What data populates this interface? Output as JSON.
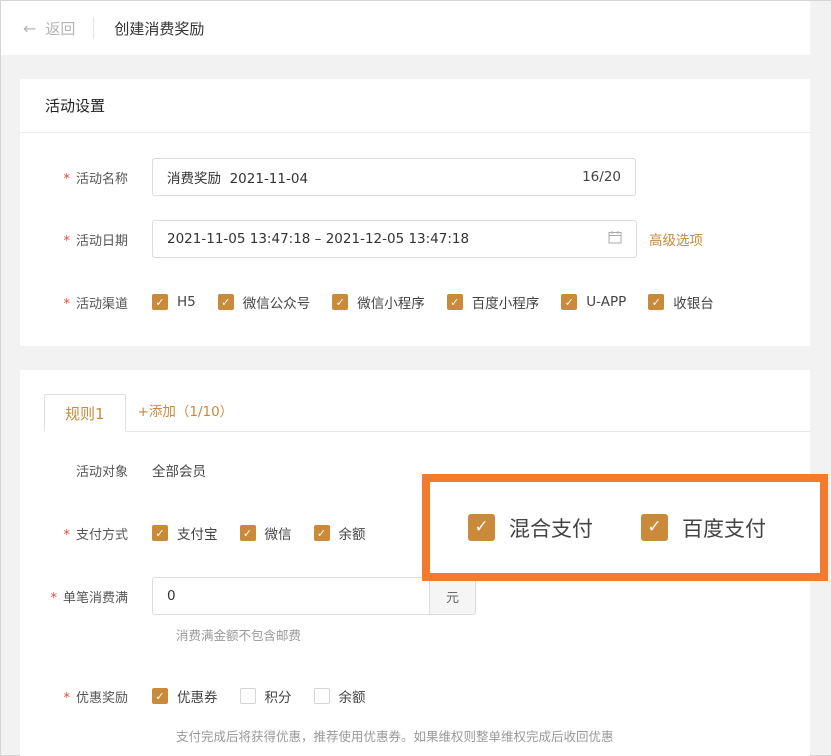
{
  "topbar": {
    "back_label": "返回",
    "title": "创建消费奖励"
  },
  "activity": {
    "section_title": "活动设置",
    "name": {
      "label": "活动名称",
      "value": "消费奖励  2021-11-04",
      "count": "16/20"
    },
    "date": {
      "label": "活动日期",
      "value": "2021-11-05 13:47:18 – 2021-12-05 13:47:18",
      "advanced": "高级选项"
    },
    "channels": {
      "label": "活动渠道",
      "items": [
        {
          "label": "H5",
          "checked": true
        },
        {
          "label": "微信公众号",
          "checked": true
        },
        {
          "label": "微信小程序",
          "checked": true
        },
        {
          "label": "百度小程序",
          "checked": true
        },
        {
          "label": "U-APP",
          "checked": true
        },
        {
          "label": "收银台",
          "checked": true
        }
      ]
    }
  },
  "rules": {
    "tabs": [
      {
        "label": "规则1"
      }
    ],
    "add_label": "+添加（1/10）",
    "target": {
      "label": "活动对象",
      "value": "全部会员"
    },
    "payment": {
      "label": "支付方式",
      "items": [
        {
          "label": "支付宝",
          "checked": true
        },
        {
          "label": "微信",
          "checked": true
        },
        {
          "label": "余额",
          "checked": true
        }
      ],
      "callout_items": [
        {
          "label": "混合支付",
          "checked": true
        },
        {
          "label": "百度支付",
          "checked": true
        }
      ]
    },
    "min_spend": {
      "label": "单笔消费满",
      "value": "0",
      "unit": "元",
      "hint": "消费满金额不包含邮费"
    },
    "reward": {
      "label": "优惠奖励",
      "items": [
        {
          "label": "优惠券",
          "checked": true
        },
        {
          "label": "积分",
          "checked": false
        },
        {
          "label": "余额",
          "checked": false
        }
      ],
      "hint": "支付完成后将获得优惠，推荐使用优惠券。如果维权则整单维权完成后收回优惠"
    }
  },
  "colors": {
    "accent": "#c98a3a",
    "required": "#e04b3a",
    "callout_border": "#f47a2e"
  }
}
